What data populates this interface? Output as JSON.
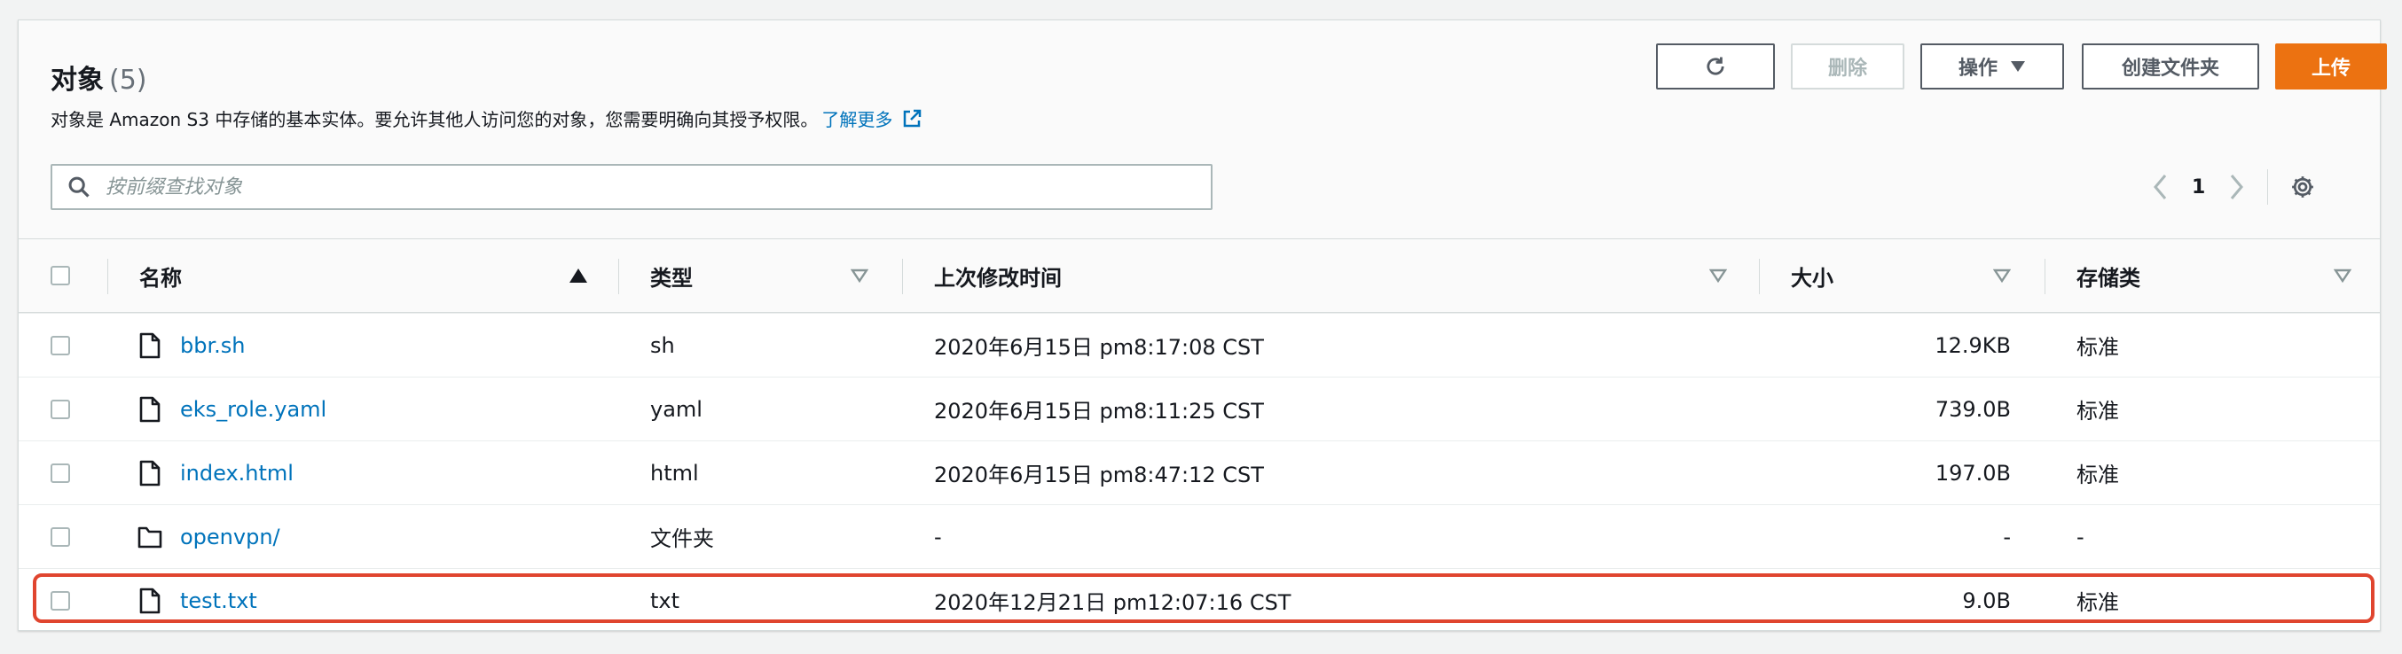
{
  "header": {
    "title": "对象",
    "count": "(5)",
    "description": "对象是 Amazon S3 中存储的基本实体。要允许其他人访问您的对象，您需要明确向其授予权限。",
    "learn_more": "了解更多"
  },
  "toolbar": {
    "refresh_icon": "refresh-icon",
    "delete_label": "删除",
    "actions_label": "操作",
    "create_folder_label": "创建文件夹",
    "upload_label": "上传"
  },
  "search": {
    "placeholder": "按前缀查找对象",
    "value": ""
  },
  "pagination": {
    "page": "1"
  },
  "table": {
    "columns": [
      "名称",
      "类型",
      "上次修改时间",
      "大小",
      "存储类"
    ],
    "rows": [
      {
        "name": "bbr.sh",
        "type": "sh",
        "modified": "2020年6月15日 pm8:17:08 CST",
        "size": "12.9KB",
        "storage": "标准",
        "icon": "file-icon"
      },
      {
        "name": "eks_role.yaml",
        "type": "yaml",
        "modified": "2020年6月15日 pm8:11:25 CST",
        "size": "739.0B",
        "storage": "标准",
        "icon": "file-icon"
      },
      {
        "name": "index.html",
        "type": "html",
        "modified": "2020年6月15日 pm8:47:12 CST",
        "size": "197.0B",
        "storage": "标准",
        "icon": "file-icon"
      },
      {
        "name": "openvpn/",
        "type": "文件夹",
        "modified": "-",
        "size": "-",
        "storage": "-",
        "icon": "folder-icon"
      },
      {
        "name": "test.txt",
        "type": "txt",
        "modified": "2020年12月21日 pm12:07:16 CST",
        "size": "9.0B",
        "storage": "标准",
        "icon": "file-icon"
      }
    ]
  },
  "colors": {
    "link": "#0073bb",
    "primary": "#ec7211",
    "highlight": "#e0452f"
  }
}
